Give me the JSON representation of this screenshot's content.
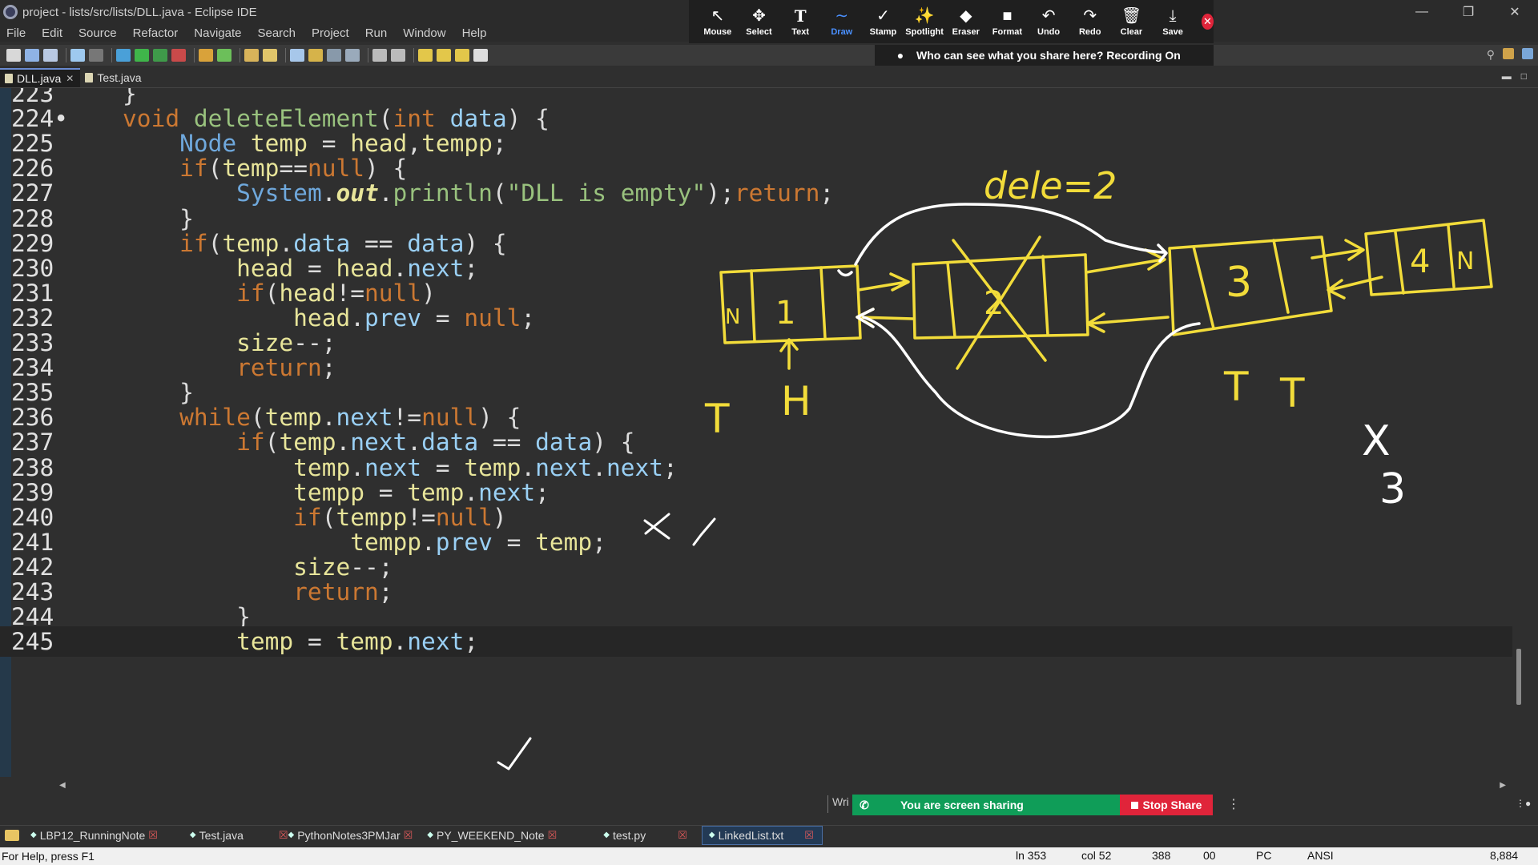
{
  "window": {
    "title": "project - lists/src/lists/DLL.java - Eclipse IDE",
    "controls": [
      "—",
      "❐",
      "✕"
    ]
  },
  "menu": [
    "File",
    "Edit",
    "Source",
    "Refactor",
    "Navigate",
    "Search",
    "Project",
    "Run",
    "Window",
    "Help"
  ],
  "zoom_tools": [
    {
      "label": "Mouse",
      "icon": "mouse-pointer-icon",
      "glyph": "↖"
    },
    {
      "label": "Select",
      "icon": "move-arrows-icon",
      "glyph": "✥"
    },
    {
      "label": "Text",
      "icon": "text-icon",
      "glyph": "T"
    },
    {
      "label": "Draw",
      "icon": "squiggle-icon",
      "glyph": "∼"
    },
    {
      "label": "Stamp",
      "icon": "checkmark-icon",
      "glyph": "✓"
    },
    {
      "label": "Spotlight",
      "icon": "magic-wand-icon",
      "glyph": "✨"
    },
    {
      "label": "Eraser",
      "icon": "eraser-icon",
      "glyph": "◆"
    },
    {
      "label": "Format",
      "icon": "format-square-icon",
      "glyph": "■"
    },
    {
      "label": "Undo",
      "icon": "undo-icon",
      "glyph": "↶"
    },
    {
      "label": "Redo",
      "icon": "redo-icon",
      "glyph": "↷"
    },
    {
      "label": "Clear",
      "icon": "trash-icon",
      "glyph": "🗑"
    },
    {
      "label": "Save",
      "icon": "download-icon",
      "glyph": "⤓"
    }
  ],
  "zoom_active": "Draw",
  "recording_banner": "Who can see what you share here? Recording On",
  "editor_tabs": [
    {
      "label": "DLL.java",
      "active": true,
      "closable": true
    },
    {
      "label": "Test.java",
      "active": false,
      "closable": false
    }
  ],
  "code": {
    "lines": [
      {
        "n": "223",
        "text": "    }"
      },
      {
        "n": "224•",
        "text": "    void deleteElement(int data) {"
      },
      {
        "n": "225",
        "text": "        Node temp = head,tempp;"
      },
      {
        "n": "226",
        "text": "        if(temp==null) {"
      },
      {
        "n": "227",
        "text": "            System.out.println(\"DLL is empty\");return;"
      },
      {
        "n": "228",
        "text": "        }"
      },
      {
        "n": "229",
        "text": "        if(temp.data == data) {"
      },
      {
        "n": "230",
        "text": "            head = head.next;"
      },
      {
        "n": "231",
        "text": "            if(head!=null)"
      },
      {
        "n": "232",
        "text": "                head.prev = null;"
      },
      {
        "n": "233",
        "text": "            size--;"
      },
      {
        "n": "234",
        "text": "            return;"
      },
      {
        "n": "235",
        "text": "        }"
      },
      {
        "n": "236",
        "text": "        while(temp.next!=null) {"
      },
      {
        "n": "237",
        "text": "            if(temp.next.data == data) {"
      },
      {
        "n": "238",
        "text": "                temp.next = temp.next.next;"
      },
      {
        "n": "239",
        "text": "                tempp = temp.next;"
      },
      {
        "n": "240",
        "text": "                if(tempp!=null)"
      },
      {
        "n": "241",
        "text": "                    tempp.prev = temp;"
      },
      {
        "n": "242",
        "text": "                size--;"
      },
      {
        "n": "243",
        "text": "                return;"
      },
      {
        "n": "244",
        "text": "            }"
      },
      {
        "n": "245",
        "text": "            temp = temp.next;"
      }
    ]
  },
  "annotations": {
    "heading": "dele=2",
    "nodes": [
      "N",
      "1",
      "2",
      "3",
      "4",
      "N"
    ],
    "labels": [
      "T",
      "H",
      "T",
      "T",
      "X",
      "3"
    ]
  },
  "write_box": "Wri",
  "share_bar": {
    "message": "You are screen sharing",
    "stop_label": "Stop Share"
  },
  "task_strip": [
    {
      "label": "LBP12_RunningNote",
      "closable": true,
      "selected": false
    },
    {
      "label": "Test.java",
      "closable": false,
      "selected": false
    },
    {
      "label": "PythonNotes3PMJar",
      "closable": true,
      "selected": false
    },
    {
      "label": "PY_WEEKEND_Note",
      "closable": true,
      "selected": false
    },
    {
      "label": "test.py",
      "closable": false,
      "selected": false
    },
    {
      "label": "LinkedList.txt",
      "closable": true,
      "selected": true
    }
  ],
  "status": {
    "help": "For Help, press F1",
    "line": "ln 353",
    "col": "col 52",
    "c1": "388",
    "c2": "00",
    "c3": "PC",
    "encoding": "ANSI",
    "count": "8,884"
  },
  "colors": {
    "accent": "#4a90ff",
    "ink": "#f2dc3a",
    "share_green": "#0f9d58",
    "stop_red": "#e0243a"
  }
}
